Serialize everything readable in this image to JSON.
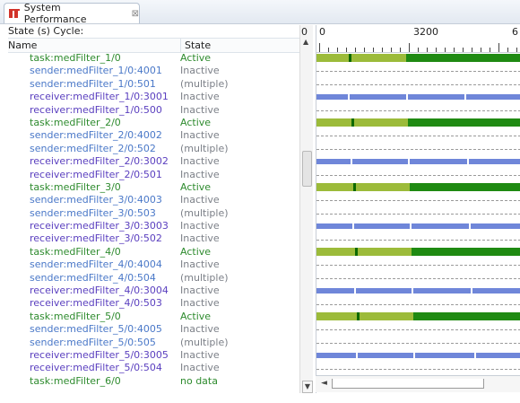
{
  "tab": {
    "title": "System Performance",
    "icon": "performance-icon",
    "close_glyph": "⊠"
  },
  "header": {
    "cycle_label": "State (s) Cycle:",
    "cycle_value": "0",
    "col_name": "Name",
    "col_state": "State"
  },
  "ruler": {
    "labels": [
      "0",
      "3200",
      "6"
    ]
  },
  "colors": {
    "active_light": "#9cbb3a",
    "active_dark": "#1f8a12",
    "marker": "#0d6a00",
    "blue": "#6f86d9"
  },
  "rows": [
    {
      "name": "task:medFilter_1/0",
      "state": "Active",
      "kind": "task"
    },
    {
      "name": "sender:medFilter_1/0:4001",
      "state": "Inactive",
      "kind": "sender"
    },
    {
      "name": "sender:medFilter_1/0:501",
      "state": "(multiple)",
      "kind": "sender"
    },
    {
      "name": "receiver:medFilter_1/0:3001",
      "state": "Inactive",
      "kind": "receiver"
    },
    {
      "name": "receiver:medFilter_1/0:500",
      "state": "Inactive",
      "kind": "receiver"
    },
    {
      "name": "task:medFilter_2/0",
      "state": "Active",
      "kind": "task"
    },
    {
      "name": "sender:medFilter_2/0:4002",
      "state": "Inactive",
      "kind": "sender"
    },
    {
      "name": "sender:medFilter_2/0:502",
      "state": "(multiple)",
      "kind": "sender"
    },
    {
      "name": "receiver:medFilter_2/0:3002",
      "state": "Inactive",
      "kind": "receiver"
    },
    {
      "name": "receiver:medFilter_2/0:501",
      "state": "Inactive",
      "kind": "receiver"
    },
    {
      "name": "task:medFilter_3/0",
      "state": "Active",
      "kind": "task"
    },
    {
      "name": "sender:medFilter_3/0:4003",
      "state": "Inactive",
      "kind": "sender"
    },
    {
      "name": "sender:medFilter_3/0:503",
      "state": "(multiple)",
      "kind": "sender"
    },
    {
      "name": "receiver:medFilter_3/0:3003",
      "state": "Inactive",
      "kind": "receiver"
    },
    {
      "name": "receiver:medFilter_3/0:502",
      "state": "Inactive",
      "kind": "receiver"
    },
    {
      "name": "task:medFilter_4/0",
      "state": "Active",
      "kind": "task"
    },
    {
      "name": "sender:medFilter_4/0:4004",
      "state": "Inactive",
      "kind": "sender"
    },
    {
      "name": "sender:medFilter_4/0:504",
      "state": "(multiple)",
      "kind": "sender"
    },
    {
      "name": "receiver:medFilter_4/0:3004",
      "state": "Inactive",
      "kind": "receiver"
    },
    {
      "name": "receiver:medFilter_4/0:503",
      "state": "Inactive",
      "kind": "receiver"
    },
    {
      "name": "task:medFilter_5/0",
      "state": "Active",
      "kind": "task"
    },
    {
      "name": "sender:medFilter_5/0:4005",
      "state": "Inactive",
      "kind": "sender"
    },
    {
      "name": "sender:medFilter_5/0:505",
      "state": "(multiple)",
      "kind": "sender"
    },
    {
      "name": "receiver:medFilter_5/0:3005",
      "state": "Inactive",
      "kind": "receiver"
    },
    {
      "name": "receiver:medFilter_5/0:504",
      "state": "Inactive",
      "kind": "receiver"
    },
    {
      "name": "task:medFilter_6/0",
      "state": "no data",
      "kind": "task"
    }
  ],
  "scrollbar": {
    "up_glyph": "▲",
    "down_glyph": "▼",
    "grip_glyph": "≡",
    "left_glyph": "◄"
  }
}
